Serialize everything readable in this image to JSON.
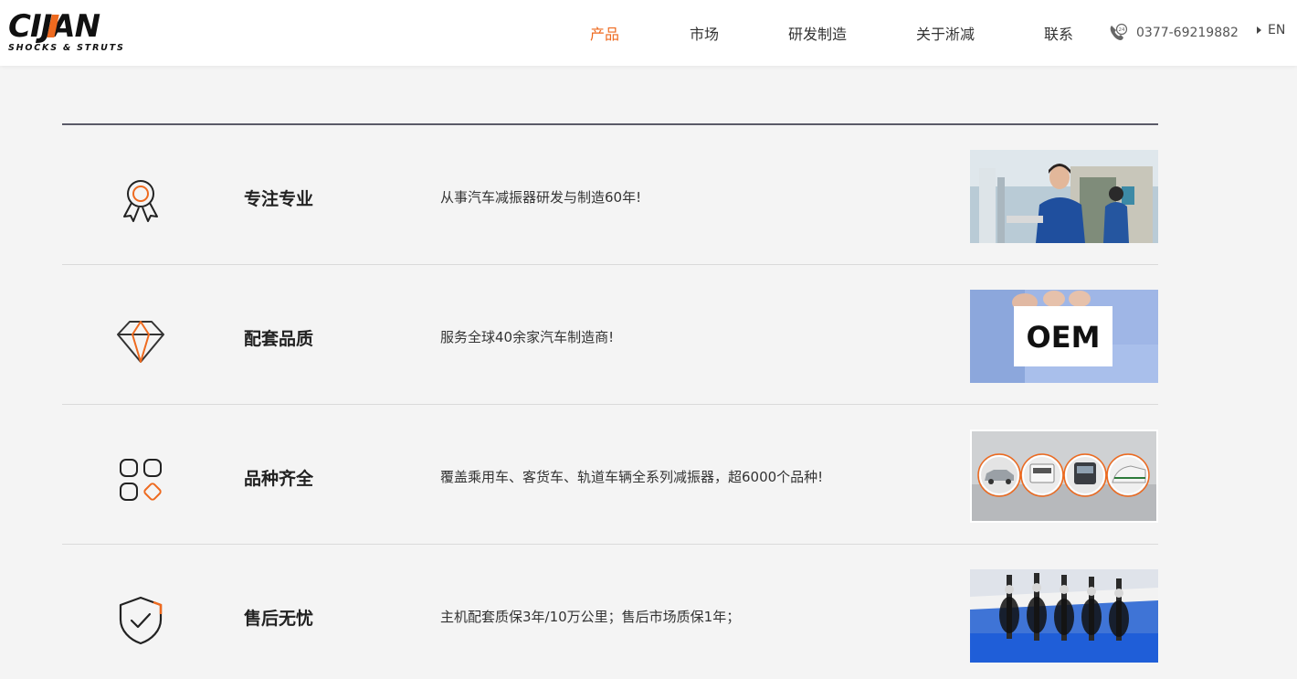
{
  "brand": {
    "logo_text": "CIJAN",
    "tagline": "SHOCKS & STRUTS",
    "accent_color": "#ee6a1f"
  },
  "nav": {
    "items": [
      {
        "label": "产品",
        "active": true
      },
      {
        "label": "市场",
        "active": false
      },
      {
        "label": "研发制造",
        "active": false
      },
      {
        "label": "关于淅减",
        "active": false
      },
      {
        "label": "联系",
        "active": false
      }
    ],
    "phone_icon": "phone-24h-icon",
    "phone": "0377-69219882",
    "lang": "EN"
  },
  "features": [
    {
      "icon": "award-ribbon-icon",
      "title": "专注专业",
      "desc": "从事汽车减振器研发与制造60年!",
      "photo": "factory-worker-photo"
    },
    {
      "icon": "diamond-icon",
      "title": "配套品质",
      "desc": "服务全球40余家汽车制造商!",
      "photo": "oem-card-photo",
      "photo_text": "OEM"
    },
    {
      "icon": "grid-apps-icon",
      "title": "品种齐全",
      "desc": "覆盖乘用车、客货车、轨道车辆全系列减振器，超6000个品种!",
      "photo": "vehicle-types-photo"
    },
    {
      "icon": "shield-check-icon",
      "title": "售后无忧",
      "desc": "主机配套质保3年/10万公里；售后市场质保1年；",
      "photo": "shock-absorbers-photo"
    }
  ]
}
